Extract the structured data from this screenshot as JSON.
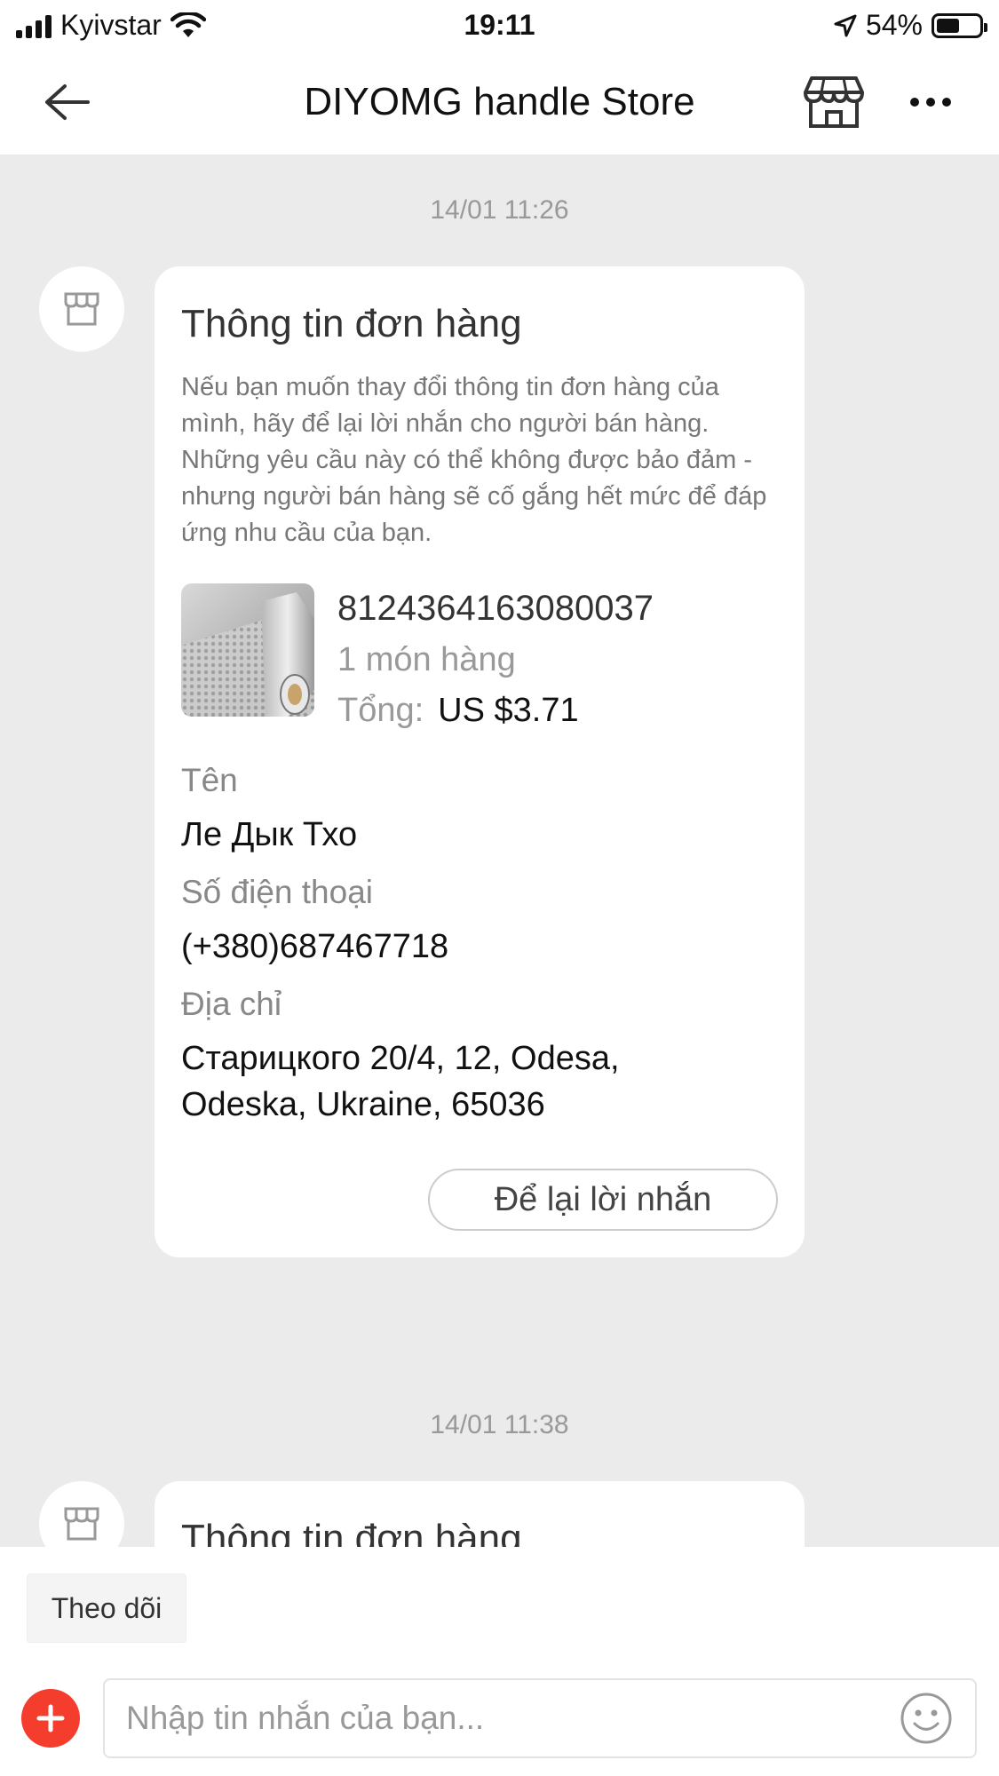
{
  "status_bar": {
    "carrier": "Kyivstar",
    "time": "19:11",
    "battery": "54%",
    "battery_level": 0.54
  },
  "header": {
    "title": "DIYOMG handle Store",
    "back_icon": "arrow-left-icon",
    "store_icon": "storefront-icon",
    "more_icon": "more-horizontal-icon"
  },
  "messages": [
    {
      "timestamp": "14/01 11:26",
      "card": {
        "title": "Thông tin đơn hàng",
        "description": "Nếu bạn muốn thay đổi thông tin đơn hàng của mình, hãy để lại lời nhắn cho người bán hàng. Những yêu cầu này có thể không được bảo đảm - nhưng người bán hàng sẽ cố gắng hết mức để đáp ứng nhu cầu của bạn.",
        "order_id": "8124364163080037",
        "item_count": "1 món hàng",
        "total_label": "Tổng:",
        "total_value": "US $3.71",
        "name_label": "Tên",
        "name_value": "Ле Дык Тхо",
        "phone_label": "Số điện thoại",
        "phone_value": "(+380)687467718",
        "address_label": "Địa chỉ",
        "address_value": "Старицкого 20/4, 12, Odesa, Odeska, Ukraine, 65036",
        "button_label": "Để lại lời nhắn"
      }
    },
    {
      "timestamp": "14/01 11:38",
      "card": {
        "title": "Thông tin đơn hàng"
      }
    }
  ],
  "composer": {
    "follow_label": "Theo dõi",
    "input_placeholder": "Nhập tin nhắn của bạn...",
    "plus_icon": "plus-icon",
    "emoji_icon": "smiley-icon",
    "accent_color": "#f53d2d"
  }
}
